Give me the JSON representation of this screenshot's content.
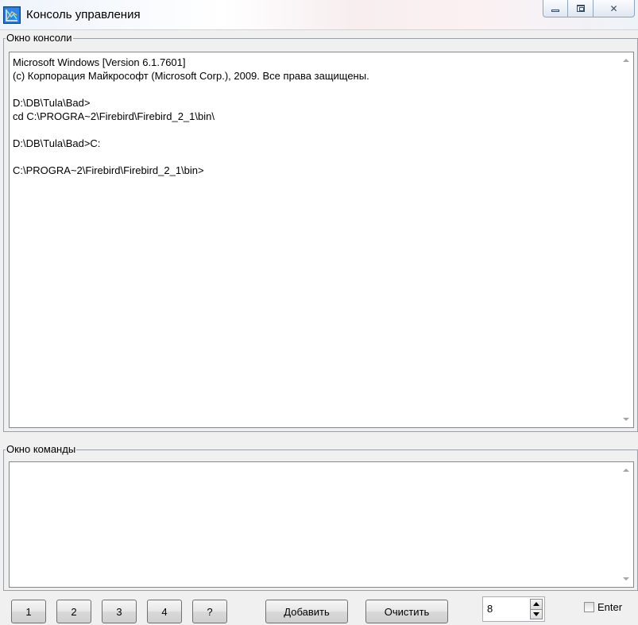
{
  "window": {
    "title": "Консоль управления",
    "icon": "app-chart-icon",
    "controls": {
      "minimize": "minimize-icon",
      "maximize": "maximize-icon",
      "close": "close-icon",
      "close_glyph": "✕"
    }
  },
  "console_group": {
    "label": "Окно консоли",
    "text": "Microsoft Windows [Version 6.1.7601]\n(c) Корпорация Майкрософт (Microsoft Corp.), 2009. Все права защищены.\n\nD:\\DB\\Tula\\Bad>\ncd C:\\PROGRA~2\\Firebird\\Firebird_2_1\\bin\\\n\nD:\\DB\\Tula\\Bad>C:\n\nC:\\PROGRA~2\\Firebird\\Firebird_2_1\\bin>"
  },
  "command_group": {
    "label": "Окно команды",
    "text": ""
  },
  "toolbar": {
    "buttons": [
      "1",
      "2",
      "3",
      "4",
      "?"
    ],
    "add_label": "Добавить",
    "clear_label": "Очистить",
    "spin_value": "8",
    "enter_label": "Enter"
  }
}
